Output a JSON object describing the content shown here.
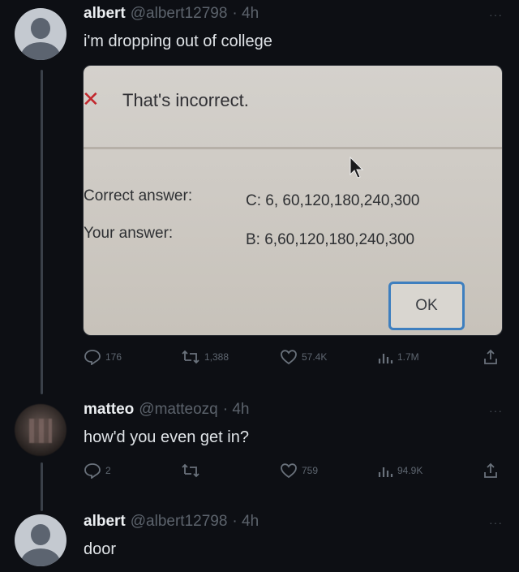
{
  "tweets": [
    {
      "name": "albert",
      "handle": "@albert12798",
      "time": "· 4h",
      "text": "i'm dropping out of college",
      "more": "···",
      "media": {
        "title": "That's incorrect.",
        "correct_label": "Correct answer:",
        "correct_value": "C: 6, 60,120,180,240,300",
        "your_label": "Your answer:",
        "your_value": "B: 6,60,120,180,240,300",
        "ok_label": "OK"
      },
      "stats": {
        "replies": "176",
        "retweets": "1,388",
        "likes": "57.4K",
        "views": "1.7M"
      }
    },
    {
      "name": "matteo",
      "handle": "@matteozq",
      "time": "· 4h",
      "text": "how'd you even get in?",
      "more": "···",
      "stats": {
        "replies": "2",
        "retweets": "",
        "likes": "759",
        "views": "94.9K"
      }
    },
    {
      "name": "albert",
      "handle": "@albert12798",
      "time": "· 4h",
      "text": "door",
      "more": "···"
    }
  ],
  "colors": {
    "background": "#0d0f14",
    "error_x": "#c2272d",
    "ok_border": "#3e7fbf"
  }
}
